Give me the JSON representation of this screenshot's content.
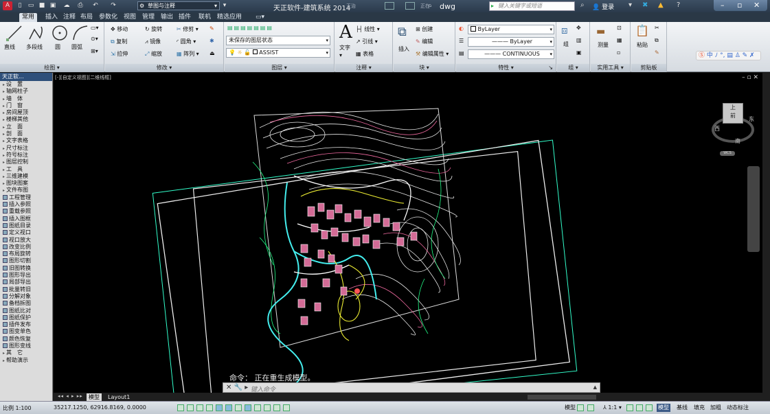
{
  "title_bar": {
    "workspace": "草图与注释",
    "app_title": "天正软件-建筑系统 2014",
    "small_tag": "王治",
    "file_tag": "正在",
    "file_name": "dwg",
    "search_placeholder": "键入关键字或短语",
    "login": "登录"
  },
  "ribbon_tabs": [
    "常用",
    "插入",
    "注释",
    "布局",
    "参数化",
    "视图",
    "管理",
    "输出",
    "插件",
    "联机",
    "精选应用"
  ],
  "draw_panel": {
    "title": "绘图",
    "line": "直线",
    "polyline": "多段线",
    "circle": "圆",
    "arc": "圆弧"
  },
  "modify_panel": {
    "title": "修改",
    "move": "移动",
    "rotate": "旋转",
    "trim": "修剪",
    "copy": "复制",
    "mirror": "镜像",
    "fillet": "圆角",
    "stretch": "拉伸",
    "scale": "缩放",
    "array": "阵列"
  },
  "layers_panel": {
    "title": "图层",
    "state": "未保存的图层状态",
    "layer": "ASSIST"
  },
  "annotation_panel": {
    "title": "注释",
    "text": "文字",
    "linear": "线性",
    "leader": "引线",
    "table": "表格"
  },
  "block_panel": {
    "title": "块",
    "insert": "插入",
    "create": "创建",
    "edit": "编辑",
    "edit_attr": "编辑属性"
  },
  "properties_panel": {
    "title": "特性",
    "color": "ByLayer",
    "lineweight": "ByLayer",
    "linetype": "CONTINUOUS"
  },
  "groups_panel": {
    "title": "组",
    "group": "组"
  },
  "utilities_panel": {
    "title": "实用工具",
    "measure": "测量"
  },
  "clipboard_panel": {
    "title": "剪贴板",
    "paste": "粘贴"
  },
  "palette": {
    "title": "天正软...",
    "items": [
      "设　置",
      "轴网柱子",
      "墙　体",
      "门　窗",
      "房间屋顶",
      "楼梯其他",
      "立　面",
      "剖　面",
      "文字表格",
      "尺寸标注",
      "符号标注",
      "图层控制",
      "工　具",
      "三维建模",
      "图块图案",
      "文件布图",
      "工程管理",
      "插入参照",
      "重载参照",
      "插入图框",
      "图纸目录",
      "定义视口",
      "视口放大",
      "改变比例",
      "布局旋转",
      "图形切割",
      "旧图转换",
      "图形导出",
      "局部导出",
      "批量转旧",
      "分解对象",
      "备档拆图",
      "图纸比对",
      "图纸保护",
      "插件发布",
      "图变单色",
      "颜色恢复",
      "图形变线",
      "其　它",
      "帮助演示"
    ]
  },
  "canvas": {
    "viewport_label": "[-][自定义视图][二维线框]",
    "viewcube": {
      "top": "上",
      "front": "前",
      "east": "东",
      "west": "西",
      "south": "南",
      "wcs": "WCS"
    },
    "command_history": "命令： 正在重生成模型。",
    "command_prompt": "键入命令"
  },
  "layout_tabs": [
    "模型",
    "Layout1"
  ],
  "status_bar": {
    "scale": "比例 1:100",
    "coords": "35217.1250, 62916.8169, 0.0000",
    "right_items": [
      "模型",
      "基线",
      "填充",
      "加粗",
      "动态标注"
    ],
    "model_label": "模型"
  },
  "colors": {
    "accent": "#3b5a86",
    "canvas": "#000000",
    "ribbon": "#e6eaee"
  }
}
